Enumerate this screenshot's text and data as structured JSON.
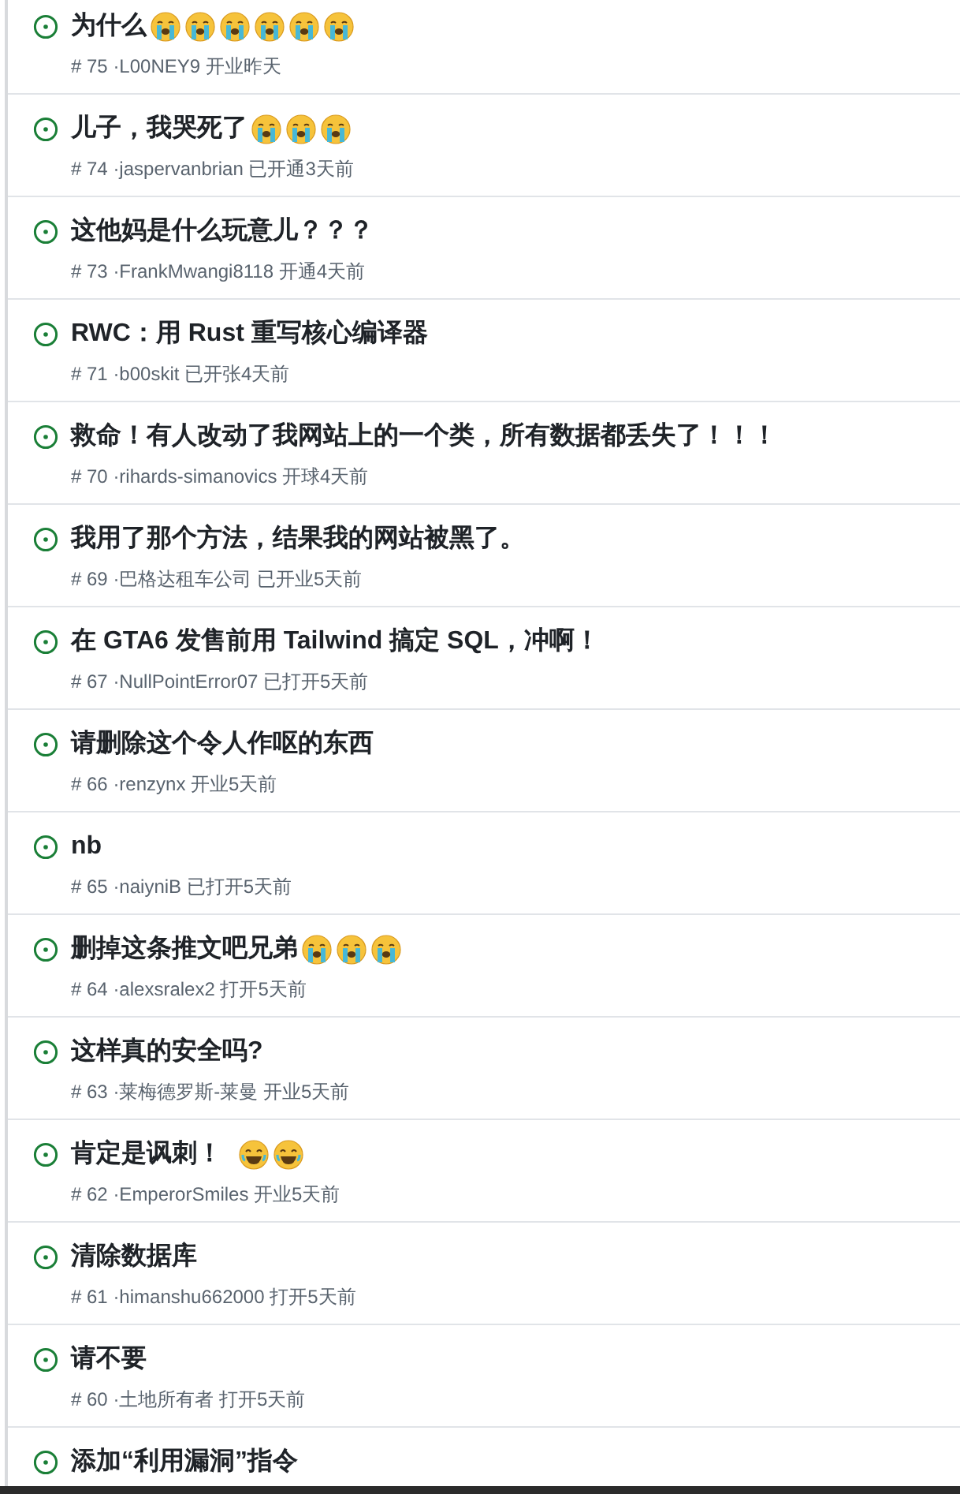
{
  "issues": [
    {
      "title": "为什么",
      "emojis": [
        {
          "kind": "crying"
        },
        {
          "kind": "crying"
        },
        {
          "kind": "crying"
        },
        {
          "kind": "crying"
        },
        {
          "kind": "crying"
        },
        {
          "kind": "crying"
        }
      ],
      "meta": "# 75 ·L00NEY9 开业昨天",
      "open": true
    },
    {
      "title": "儿子，我哭死了",
      "emojis": [
        {
          "kind": "crying"
        },
        {
          "kind": "crying"
        },
        {
          "kind": "crying"
        }
      ],
      "meta": "# 74 ·jaspervanbrian 已开通3天前",
      "open": true
    },
    {
      "title": "这他妈是什么玩意儿？？？",
      "meta": "# 73 ·FrankMwangi8118 开通4天前",
      "open": true
    },
    {
      "title": "RWC：用 Rust 重写核心编译器",
      "meta": "# 71 ·b00skit 已开张4天前",
      "open": true
    },
    {
      "title": "救命！有人改动了我网站上的一个类，所有数据都丢失了！！！",
      "meta": "# 70 ·rihards-simanovics 开球4天前",
      "open": true
    },
    {
      "title": "我用了那个方法，结果我的网站被黑了。",
      "meta": "# 69 ·巴格达租车公司 已开业5天前",
      "open": true
    },
    {
      "title": "在 GTA6 发售前用 Tailwind 搞定 SQL，冲啊！",
      "meta": "# 67 ·NullPointError07 已打开5天前",
      "open": true
    },
    {
      "title": "请删除这个令人作呕的东西",
      "meta": "# 66 ·renzynx 开业5天前",
      "open": true
    },
    {
      "title": "nb",
      "meta": "# 65 ·naiyniB 已打开5天前",
      "open": true
    },
    {
      "title": "删掉这条推文吧兄弟",
      "emojis": [
        {
          "kind": "crying"
        },
        {
          "kind": "crying"
        },
        {
          "kind": "crying"
        }
      ],
      "meta": "# 64 ·alexsralex2 打开5天前",
      "open": true
    },
    {
      "title": "这样真的安全吗?",
      "meta": "# 63 ·莱梅德罗斯-莱曼 开业5天前",
      "open": true
    },
    {
      "title": "肯定是讽刺！",
      "emojis": [
        {
          "kind": "laughing"
        },
        {
          "kind": "laughing"
        }
      ],
      "meta": "# 62 ·EmperorSmiles 开业5天前",
      "open": true
    },
    {
      "title": "清除数据库",
      "meta": "# 61 ·himanshu662000 打开5天前",
      "open": true
    },
    {
      "title": "请不要",
      "meta": "# 60 ·土地所有者 打开5天前",
      "open": true
    },
    {
      "title": "添加“利用漏洞”指令",
      "open": true
    }
  ]
}
